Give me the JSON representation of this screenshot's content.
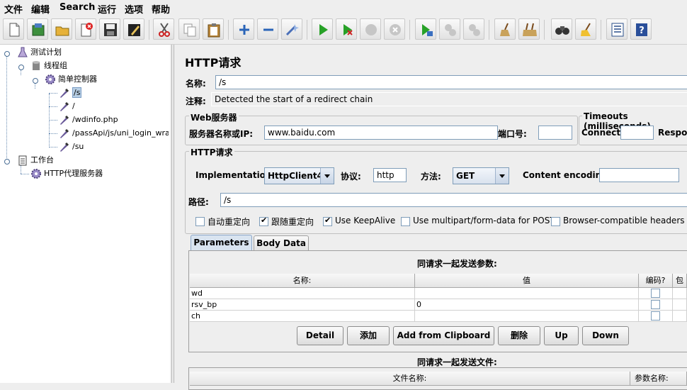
{
  "menu": [
    "文件",
    "编辑",
    "Search",
    "运行",
    "选项",
    "帮助"
  ],
  "tree": {
    "items": [
      {
        "label": "测试计划"
      },
      {
        "label": "线程组"
      },
      {
        "label": "简单控制器"
      },
      {
        "label": "/s"
      },
      {
        "label": "/"
      },
      {
        "label": "/wdinfo.php"
      },
      {
        "label": "/passApi/js/uni_login_wrapp"
      },
      {
        "label": "/su"
      },
      {
        "label": "工作台"
      },
      {
        "label": "HTTP代理服务器"
      }
    ]
  },
  "panel": {
    "title": "HTTP请求",
    "name_label": "名称:",
    "name_value": "/s",
    "comment_label": "注释:",
    "comment_value": "Detected the start of a redirect chain",
    "web_server": {
      "title": "Web服务器",
      "server_label": "服务器名称或IP:",
      "server_value": "www.baidu.com",
      "port_label": "端口号:",
      "port_value": ""
    },
    "timeouts": {
      "title": "Timeouts (milliseconds)",
      "connect_label": "Connect:",
      "response_label": "Respon"
    },
    "http_request": {
      "title": "HTTP请求",
      "impl_label": "Implementation:",
      "impl_value": "HttpClient4",
      "protocol_label": "协议:",
      "protocol_value": "http",
      "method_label": "方法:",
      "method_value": "GET",
      "encoding_label": "Content encoding:",
      "encoding_value": "",
      "path_label": "路径:",
      "path_value": "/s"
    },
    "options": [
      {
        "label": "自动重定向",
        "checked": false
      },
      {
        "label": "跟随重定向",
        "checked": true
      },
      {
        "label": "Use KeepAlive",
        "checked": true
      },
      {
        "label": "Use multipart/form-data for POST",
        "checked": false
      },
      {
        "label": "Browser-compatible headers",
        "checked": false
      }
    ],
    "tabs": [
      "Parameters",
      "Body Data"
    ],
    "params": {
      "caption": "同请求一起发送参数:",
      "columns": [
        "名称:",
        "值",
        "编码?",
        "包"
      ],
      "rows": [
        {
          "name": "wd",
          "value": ""
        },
        {
          "name": "rsv_bp",
          "value": "0"
        },
        {
          "name": "ch",
          "value": ""
        }
      ]
    },
    "buttons": [
      "Detail",
      "添加",
      "Add from Clipboard",
      "删除",
      "Up",
      "Down"
    ],
    "files": {
      "caption": "同请求一起发送文件:",
      "columns": [
        "文件名称:",
        "参数名称:"
      ]
    }
  }
}
